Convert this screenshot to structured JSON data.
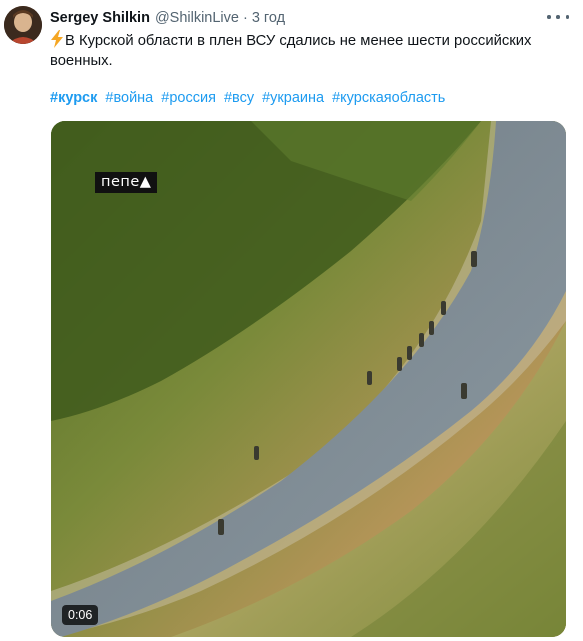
{
  "tweet": {
    "author_name": "Sergey Shilkin",
    "author_handle": "@ShilkinLive",
    "separator": "·",
    "time": "3 год",
    "text": "В Курской области в плен ВСУ сдались  не менее шести российских военных.",
    "lead_icon": "lightning-icon",
    "hashtags": [
      "#курск",
      "#война",
      "#россия",
      "#всу",
      "#украина",
      "#курскаяобласть"
    ]
  },
  "media": {
    "watermark": "пепе▲",
    "duration": "0:06"
  },
  "colors": {
    "link": "#1d9bf0",
    "secondary": "#536471",
    "text": "#0f1419"
  }
}
